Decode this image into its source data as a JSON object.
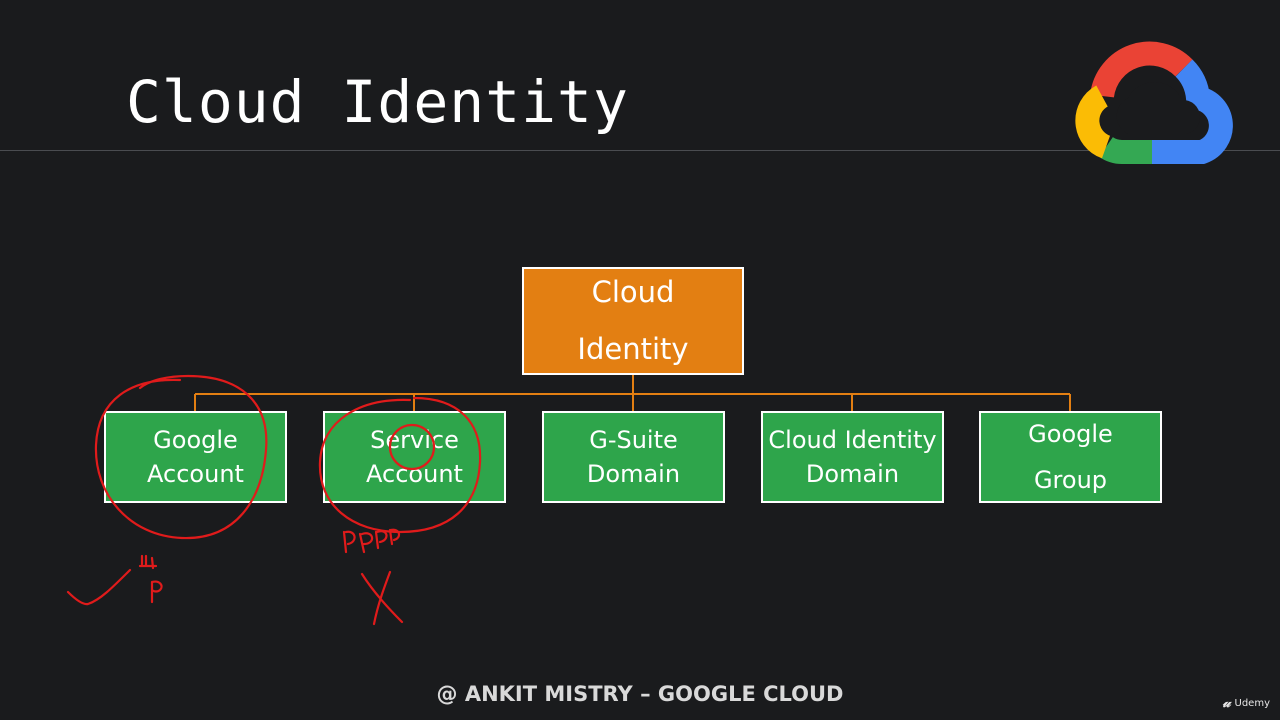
{
  "slide": {
    "title": "Cloud Identity",
    "footer": "@ ANKIT MISTRY – GOOGLE CLOUD",
    "watermark_text": "Udemy",
    "watermark_icon": "udemy-logo-icon",
    "logo_icon": "google-cloud-logo-icon"
  },
  "diagram": {
    "root": {
      "lines": [
        "Cloud",
        "Identity"
      ]
    },
    "children": [
      {
        "lines": [
          "Google",
          "Account"
        ]
      },
      {
        "lines": [
          "Service",
          "Account"
        ]
      },
      {
        "lines": [
          "G-Suite",
          "Domain"
        ]
      },
      {
        "lines": [
          "Cloud Identity",
          "Domain"
        ]
      },
      {
        "lines": [
          "Google",
          "Group"
        ]
      }
    ]
  },
  "colors": {
    "background": "#1a1b1d",
    "root_fill": "#e37f12",
    "child_fill": "#2ea54b",
    "connector": "#e37f12",
    "annotation_ink": "#e01b1b",
    "logo_red": "#ea4335",
    "logo_blue": "#4285f4",
    "logo_green": "#34a853",
    "logo_yellow": "#fbbc05"
  }
}
